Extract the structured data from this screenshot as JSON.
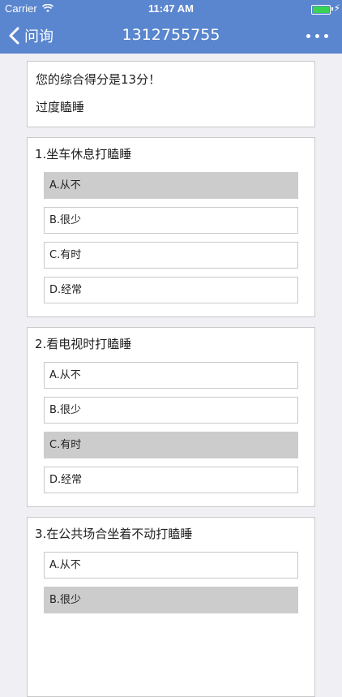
{
  "status_bar": {
    "carrier": "Carrier",
    "time": "11:47 AM"
  },
  "nav": {
    "back_label": "问询",
    "title": "1312755755"
  },
  "score": {
    "text": "您的综合得分是13分！",
    "result": "过度瞌睡"
  },
  "questions": [
    {
      "title": "1.坐车休息打瞌睡",
      "options": [
        "A.从不",
        "B.很少",
        "C.有时",
        "D.经常"
      ],
      "selected": 0
    },
    {
      "title": "2.看电视时打瞌睡",
      "options": [
        "A.从不",
        "B.很少",
        "C.有时",
        "D.经常"
      ],
      "selected": 2
    },
    {
      "title": "3.在公共场合坐着不动打瞌睡",
      "options": [
        "A.从不",
        "B.很少"
      ],
      "selected": 1
    }
  ],
  "colors": {
    "nav_bg": "#5a86cf",
    "selected_bg": "#cccccc",
    "page_bg": "#efeff4"
  }
}
